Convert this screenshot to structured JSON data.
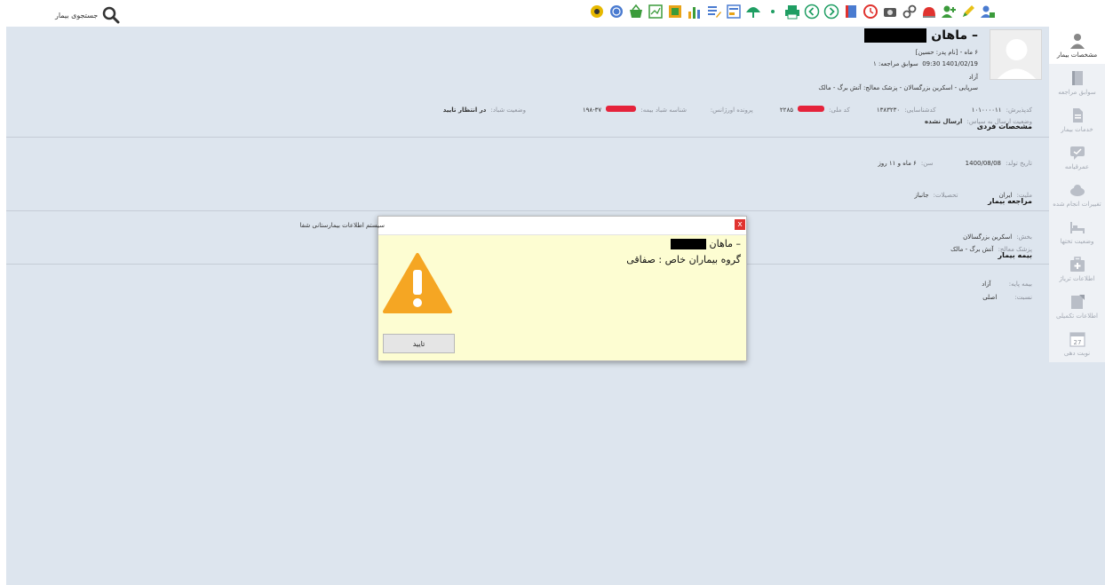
{
  "topbar": {
    "search_label": "جستجوی بیمار",
    "toolbar_icons": [
      "gear-icon",
      "fingerprint-icon",
      "basket-icon",
      "chart-box-icon",
      "flag-icon",
      "bar-chart-icon",
      "edit-list-icon",
      "form-icon",
      "umbrella-icon",
      "dot-menu-icon",
      "printer-icon",
      "back-icon",
      "forward-icon",
      "book-icon",
      "clock-icon",
      "camera-icon",
      "link-icon",
      "ambulance-icon",
      "user-add-icon",
      "pencil-icon",
      "user-lock-icon"
    ]
  },
  "sidebar": {
    "items": [
      {
        "label": "مشخصات بیمار",
        "icon": "user-icon",
        "active": true
      },
      {
        "label": "سوابق مراجعه",
        "icon": "book-icon",
        "active": false
      },
      {
        "label": "خدمات بیمار",
        "icon": "document-icon",
        "active": false
      },
      {
        "label": "عمرقیامه",
        "icon": "chat-icon",
        "active": false
      },
      {
        "label": "تغییرات انجام شده",
        "icon": "cloud-icon",
        "active": false
      },
      {
        "label": "وضعیت تختها",
        "icon": "bed-icon",
        "active": false
      },
      {
        "label": "اطلاعات ترياژ",
        "icon": "medkit-icon",
        "active": false
      },
      {
        "label": "اطلاعات تکمیلی",
        "icon": "note-icon",
        "active": false
      },
      {
        "label": "نوبت دهی",
        "icon": "calendar-icon",
        "active": false,
        "day": "27"
      }
    ]
  },
  "patient": {
    "name_suffix": "– ماهان",
    "age_father": "۶ ماه - [نام پدر: حسین]",
    "visit_date": "1401/02/19 09:30",
    "visit_history": "سوابق مراجعه: ۱",
    "insurance_status": "آزاد",
    "department_line": "سرپایی - اسکرین بزرگسالان - پزشک معالج: آتش برگ - مالک",
    "computer_code_label": "کدپذیرش:",
    "computer_code_value": "۱۰۱۰۰۰۰۱۱",
    "national_code_label": "کدشناسایی:",
    "national_code_value": "۱۳۸۳۲۳۰",
    "melli_code_label": "کد ملی:",
    "melli_code_value": "۲۲۸۵",
    "emergency_file_label": "پرونده اورژانس:",
    "shebad_label": "شناسه شباد بیمه:",
    "shebad_value": "۳۷-۱۹۸",
    "shebad_status_label": "وضعیت شباد:",
    "shebad_status_value": "در انتظار تایید",
    "send_status_label": "وضعیت ارسال به سپاس:",
    "send_status_value": "ارسال نشده"
  },
  "personal": {
    "title": "مشخصات فردی",
    "birth_label": "تاریخ تولد:",
    "birth_value": "1400/08/08",
    "age_label": "سن:",
    "age_value": "۶ ماه و ۱۱ روز",
    "nationality_label": "ملیت:",
    "nationality_value": "ایران",
    "education_label": "تحصیلات:",
    "education_value": "جانباز"
  },
  "visit": {
    "title": "مراجعه بیمار",
    "section_label": "بخش:",
    "section_value": "اسکرین بزرگسالان",
    "doctor_label": "پزشک معالج:",
    "doctor_value": "آتش برگ - مالک"
  },
  "insurance": {
    "title": "بیمه بیمار",
    "base_label": "بیمه پایه:",
    "base_value": "آزاد",
    "relation_label": "نسبت:",
    "relation_value": "اصلی"
  },
  "dialog": {
    "title": "سیستم اطلاعات بیمارستانی شفا",
    "close": "x",
    "name_suffix": "– ماهان",
    "message": "گروه بیماران خاص : صفاقی",
    "ok_label": "تایید"
  }
}
